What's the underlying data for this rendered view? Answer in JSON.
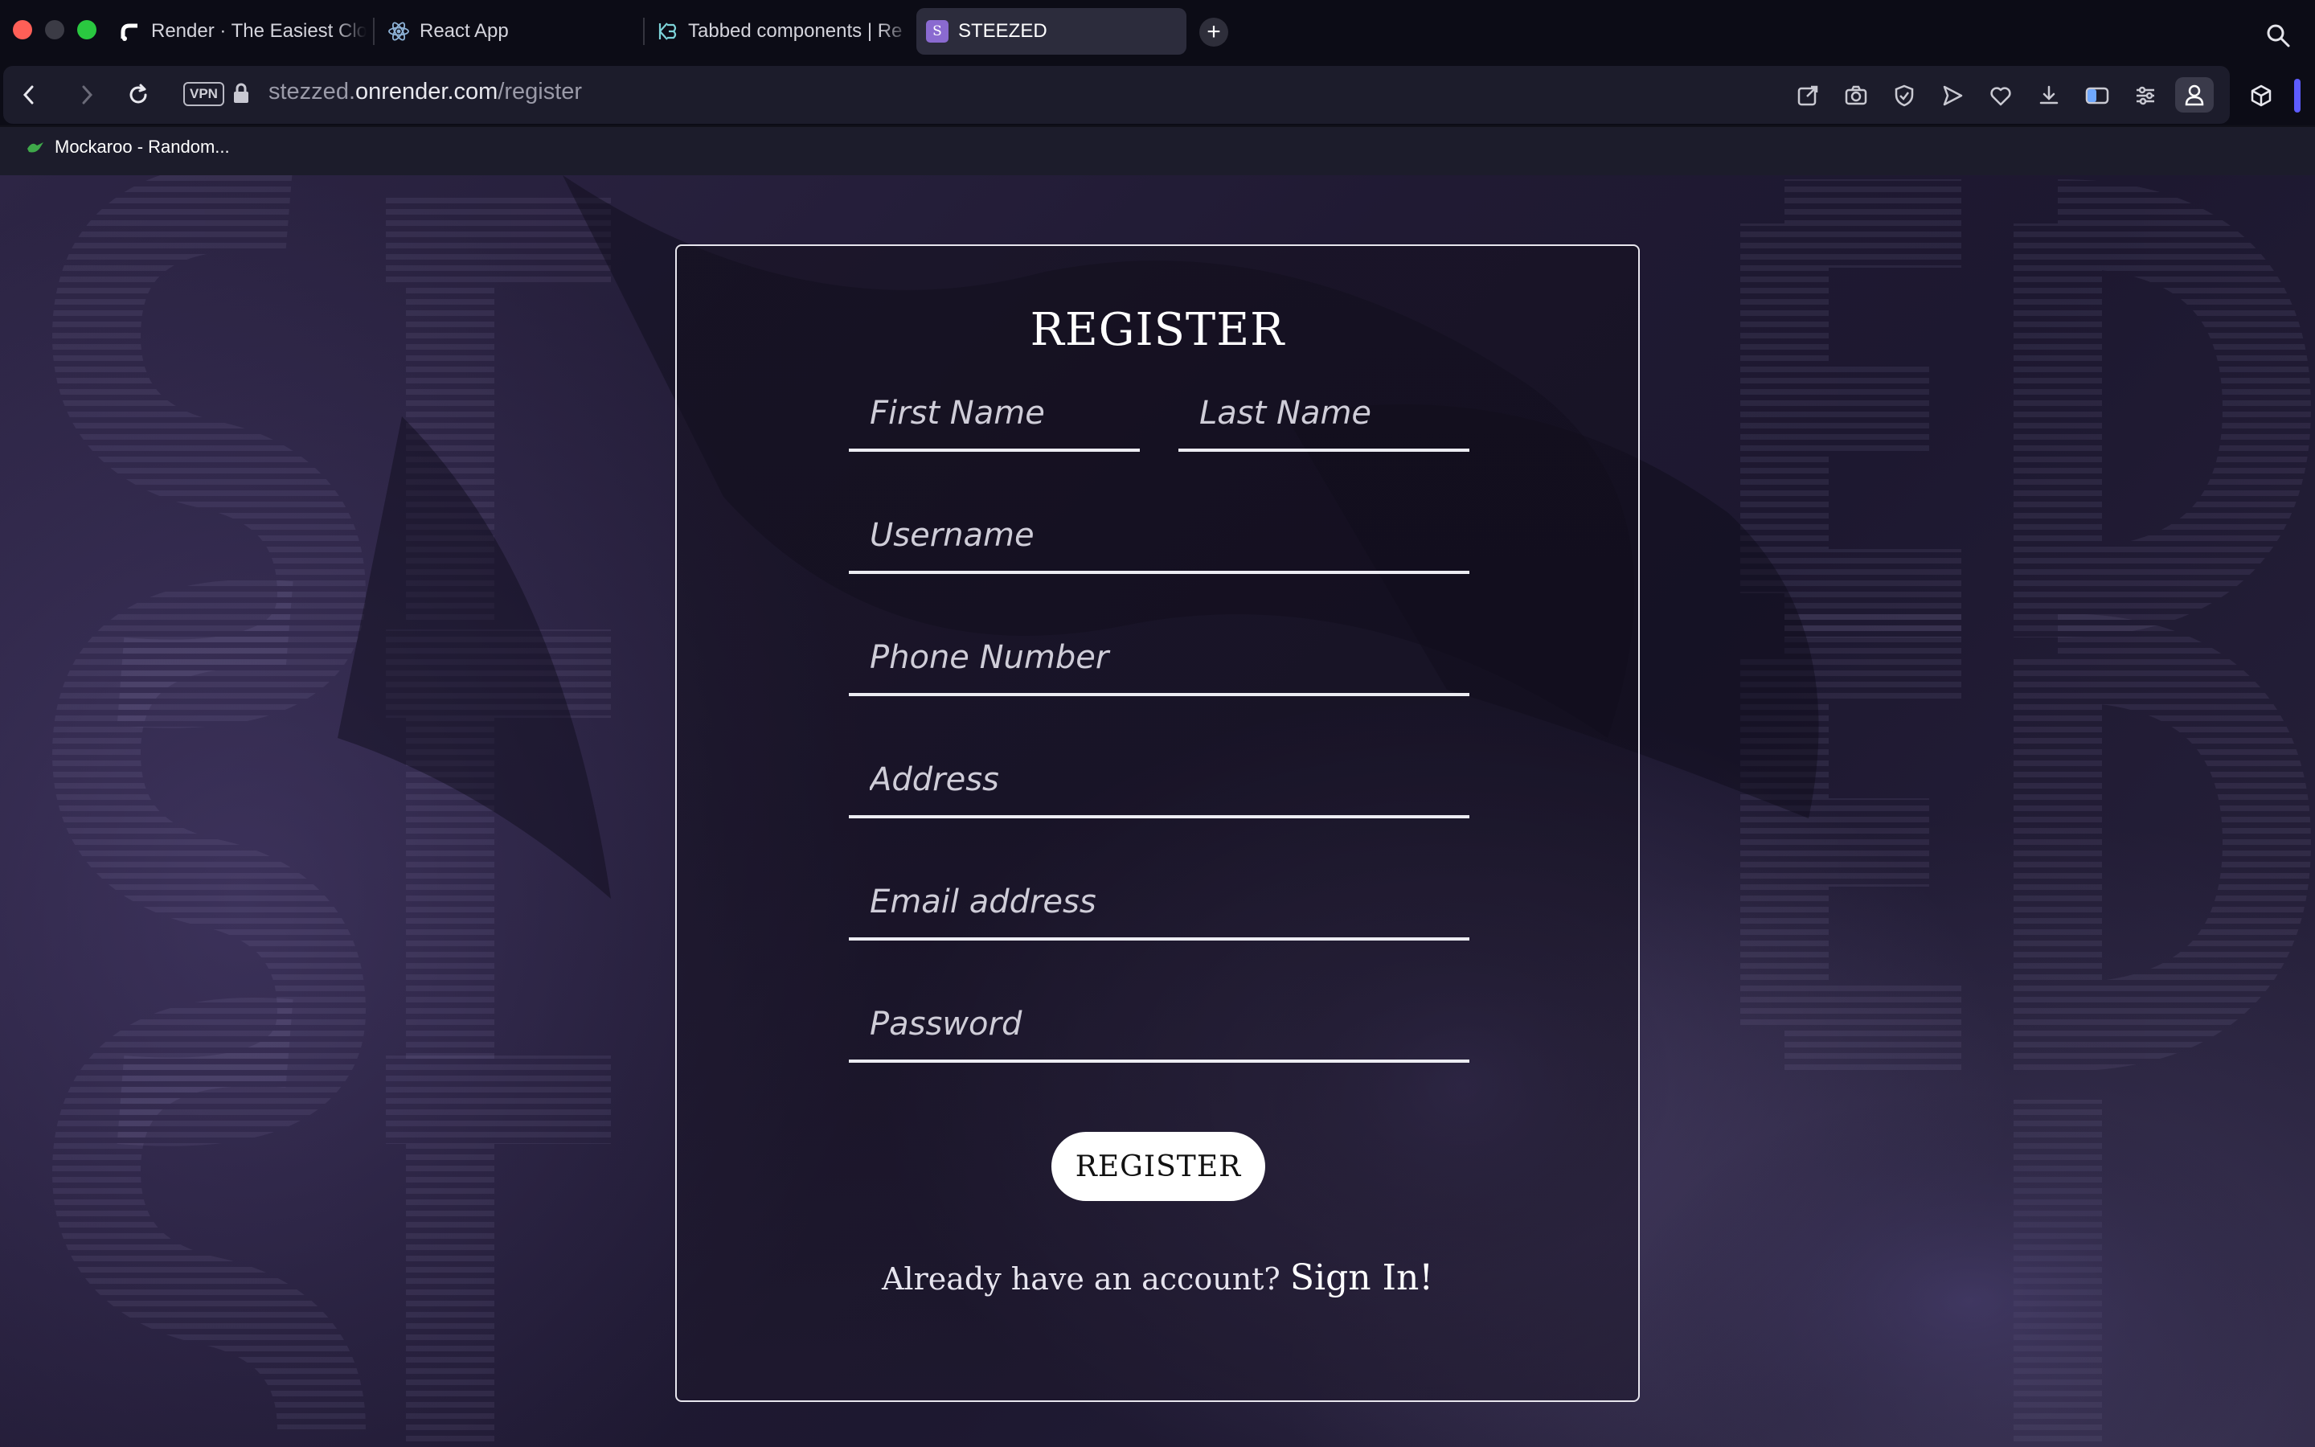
{
  "browser": {
    "tabs": [
      {
        "label": "Render · The Easiest Clo",
        "icon": "render-logo-icon"
      },
      {
        "label": "React App",
        "icon": "react-logo-icon"
      },
      {
        "label": "Tabbed components | Re",
        "icon": "chakra-logo-icon"
      },
      {
        "label": "STEEZED",
        "icon": "steezed-favicon-icon",
        "active": true,
        "favicon_letter": "S"
      }
    ],
    "url": {
      "prefix": "stezzed.",
      "host": "onrender.com",
      "path": "/register"
    },
    "vpn_label": "VPN",
    "bookmarks": [
      {
        "label": "Mockaroo - Random...",
        "icon": "mockaroo-icon"
      }
    ]
  },
  "colors": {
    "accent": "#5d5cff",
    "card_border": "#e8e6ee",
    "background": "#221c35"
  },
  "register": {
    "title": "REGISTER",
    "fields": {
      "first_name": {
        "placeholder": "First Name",
        "value": ""
      },
      "last_name": {
        "placeholder": "Last Name",
        "value": ""
      },
      "username": {
        "placeholder": "Username",
        "value": ""
      },
      "phone": {
        "placeholder": "Phone Number",
        "value": ""
      },
      "address": {
        "placeholder": "Address",
        "value": ""
      },
      "email": {
        "placeholder": "Email address",
        "value": ""
      },
      "password": {
        "placeholder": "Password",
        "value": ""
      }
    },
    "submit_label": "REGISTER",
    "signin_prompt": "Already have an account?",
    "signin_link": "Sign In!"
  }
}
